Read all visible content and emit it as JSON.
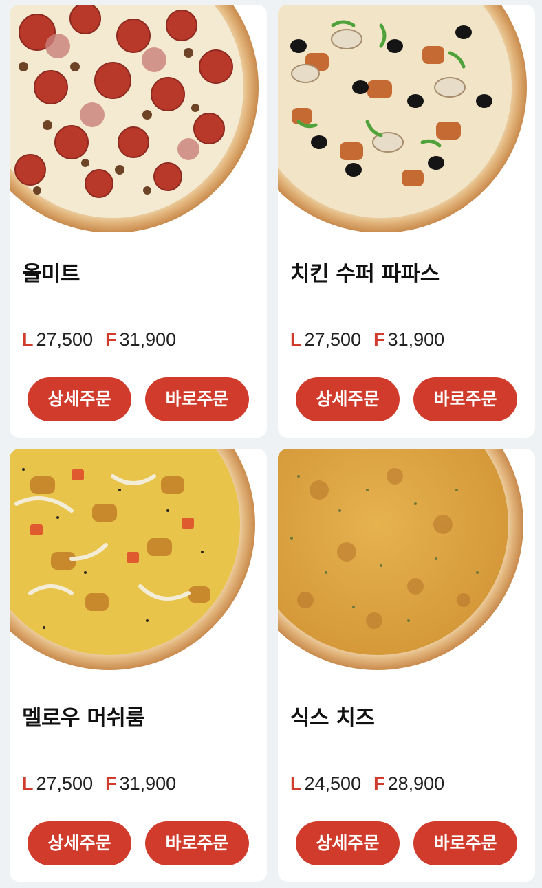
{
  "products": [
    {
      "name": "올미트",
      "large_label": "L",
      "large_price": "27,500",
      "family_label": "F",
      "family_price": "31,900",
      "detail_label": "상세주문",
      "quick_label": "바로주문",
      "image_icon": "pizza-all-meat-image"
    },
    {
      "name": "치킨 수퍼 파파스",
      "large_label": "L",
      "large_price": "27,500",
      "family_label": "F",
      "family_price": "31,900",
      "detail_label": "상세주문",
      "quick_label": "바로주문",
      "image_icon": "pizza-chicken-super-papas-image"
    },
    {
      "name": "멜로우 머쉬룸",
      "large_label": "L",
      "large_price": "27,500",
      "family_label": "F",
      "family_price": "31,900",
      "detail_label": "상세주문",
      "quick_label": "바로주문",
      "image_icon": "pizza-mellow-mushroom-image"
    },
    {
      "name": "식스 치즈",
      "large_label": "L",
      "large_price": "24,500",
      "family_label": "F",
      "family_price": "28,900",
      "detail_label": "상세주문",
      "quick_label": "바로주문",
      "image_icon": "pizza-six-cheese-image"
    }
  ],
  "colors": {
    "accent": "#d13b2b",
    "background": "#eef2f4",
    "card": "#ffffff",
    "text": "#111111"
  }
}
